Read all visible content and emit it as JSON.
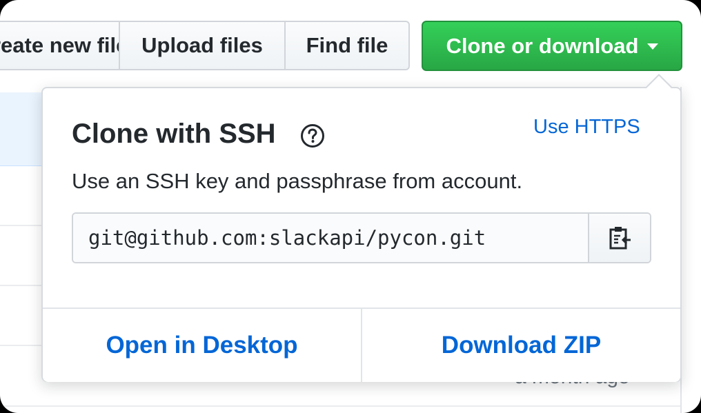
{
  "toolbar": {
    "create_label": "Create new file",
    "upload_label": "Upload files",
    "find_label": "Find file",
    "clone_label": "Clone or download"
  },
  "file_list": {
    "last_row_time": "a month ago"
  },
  "popover": {
    "title": "Clone with SSH",
    "switch_link": "Use HTTPS",
    "description": "Use an SSH key and passphrase from account.",
    "clone_url": "git@github.com:slackapi/pycon.git",
    "open_desktop": "Open in Desktop",
    "download_zip": "Download ZIP"
  },
  "colors": {
    "accent_green": "#28a745",
    "link_blue": "#0366d6",
    "text": "#24292e"
  },
  "icons": {
    "help": "question-circle-icon",
    "copy": "clipboard-icon",
    "caret": "caret-down-icon"
  }
}
